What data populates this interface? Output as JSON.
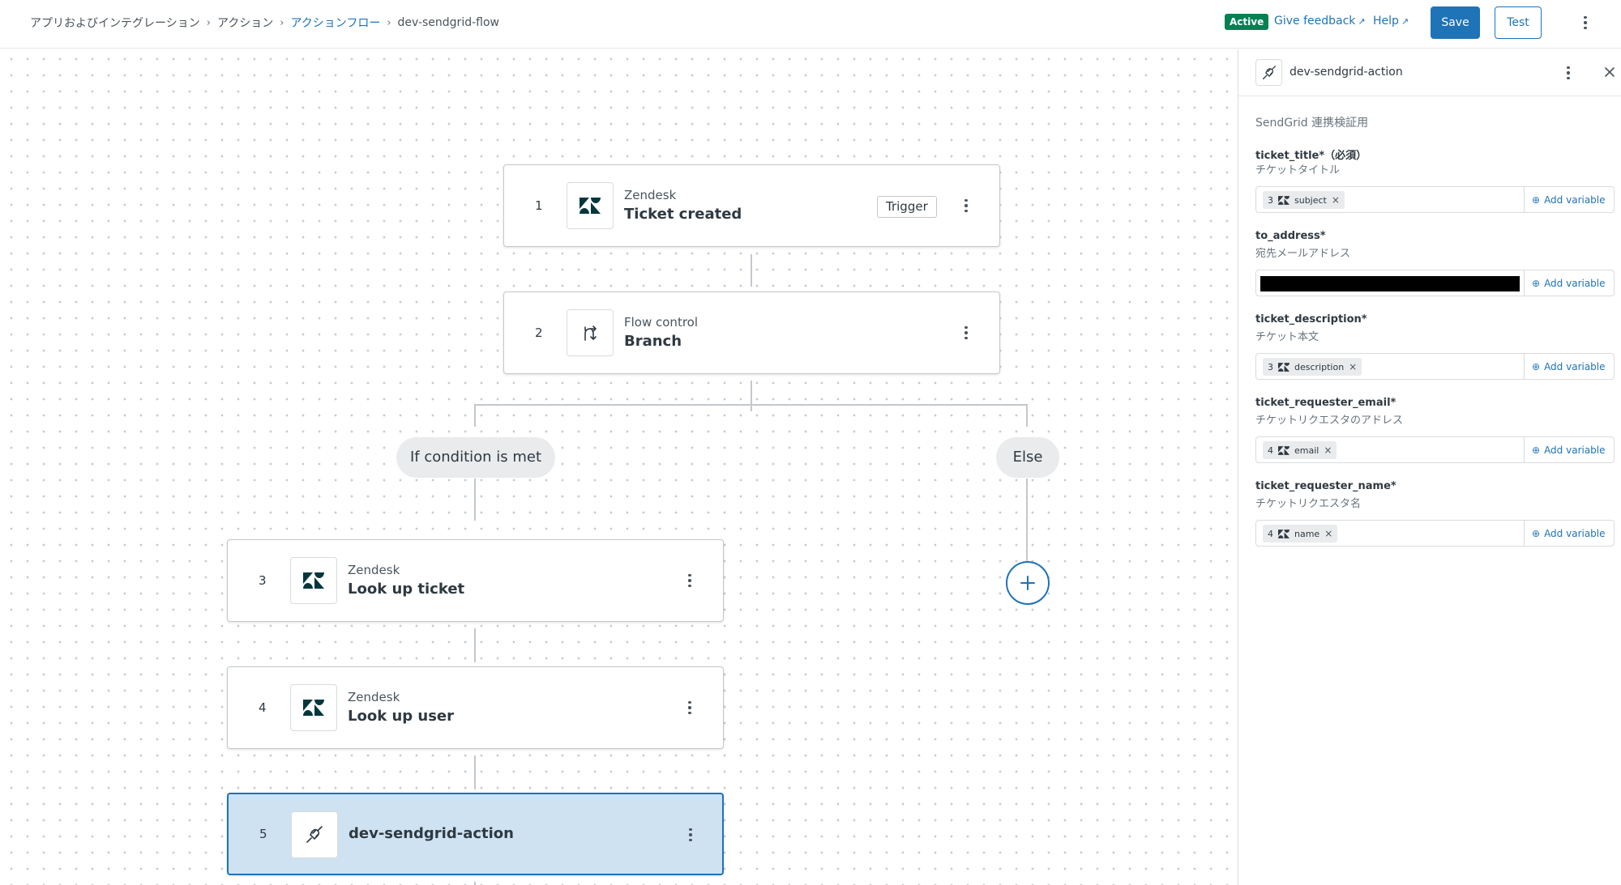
{
  "header": {
    "breadcrumb": [
      "アプリおよびインテグレーション",
      "アクション",
      "アクションフロー",
      "dev-sendgrid-flow"
    ],
    "status": "Active",
    "feedback_label": "Give feedback",
    "help_label": "Help",
    "save_label": "Save",
    "test_label": "Test"
  },
  "flow": {
    "nodes": [
      {
        "num": "1",
        "category": "Zendesk",
        "title": "Ticket created",
        "tag": "Trigger",
        "icon": "zendesk-icon"
      },
      {
        "num": "2",
        "category": "Flow control",
        "title": "Branch",
        "icon": "branch-icon"
      },
      {
        "num": "3",
        "category": "Zendesk",
        "title": "Look up ticket",
        "icon": "zendesk-icon"
      },
      {
        "num": "4",
        "category": "Zendesk",
        "title": "Look up user",
        "icon": "zendesk-icon"
      },
      {
        "num": "5",
        "title": "dev-sendgrid-action",
        "icon": "plug-icon"
      }
    ],
    "branch_labels": {
      "condition": "If condition is met",
      "else": "Else"
    }
  },
  "panel": {
    "title": "dev-sendgrid-action",
    "description": "SendGrid 連携検証用",
    "add_variable_label": "Add variable",
    "fields": [
      {
        "label": "ticket_title*（必須）",
        "hint": "チケットタイトル",
        "chip_step": "3",
        "chip_value": "subject"
      },
      {
        "label": "to_address*",
        "hint": "宛先メールアドレス",
        "redacted": true
      },
      {
        "label": "ticket_description*",
        "hint": "チケット本文",
        "chip_step": "3",
        "chip_value": "description"
      },
      {
        "label": "ticket_requester_email*",
        "hint": "チケットリクエスタのアドレス",
        "chip_step": "4",
        "chip_value": "email"
      },
      {
        "label": "ticket_requester_name*",
        "hint": "チケットリクエスタ名",
        "chip_step": "4",
        "chip_value": "name"
      }
    ]
  },
  "colors": {
    "accent": "#1f73b7",
    "active": "#038153",
    "selected_bg": "#cee2f2"
  }
}
